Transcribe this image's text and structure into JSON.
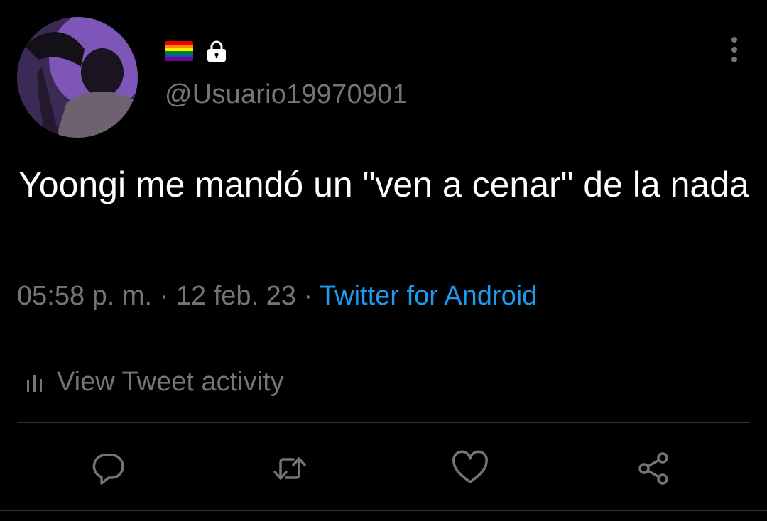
{
  "header": {
    "handle": "@Usuario19970901",
    "badges": [
      "rainbow-flag-icon",
      "lock-icon"
    ]
  },
  "tweet": {
    "text": "Yoongi me mandó un \"ven a cenar\" de la nada",
    "time": "05:58 p. m.",
    "separator": "·",
    "date": "12 feb. 23",
    "source": "Twitter for Android"
  },
  "activity": {
    "label": "View Tweet activity"
  },
  "actions": [
    "reply-icon",
    "retweet-icon",
    "like-icon",
    "share-icon"
  ],
  "colors": {
    "background": "#000000",
    "text": "#ffffff",
    "muted": "#71767b",
    "accent": "#1d9bf0",
    "divider": "#2f3336"
  }
}
